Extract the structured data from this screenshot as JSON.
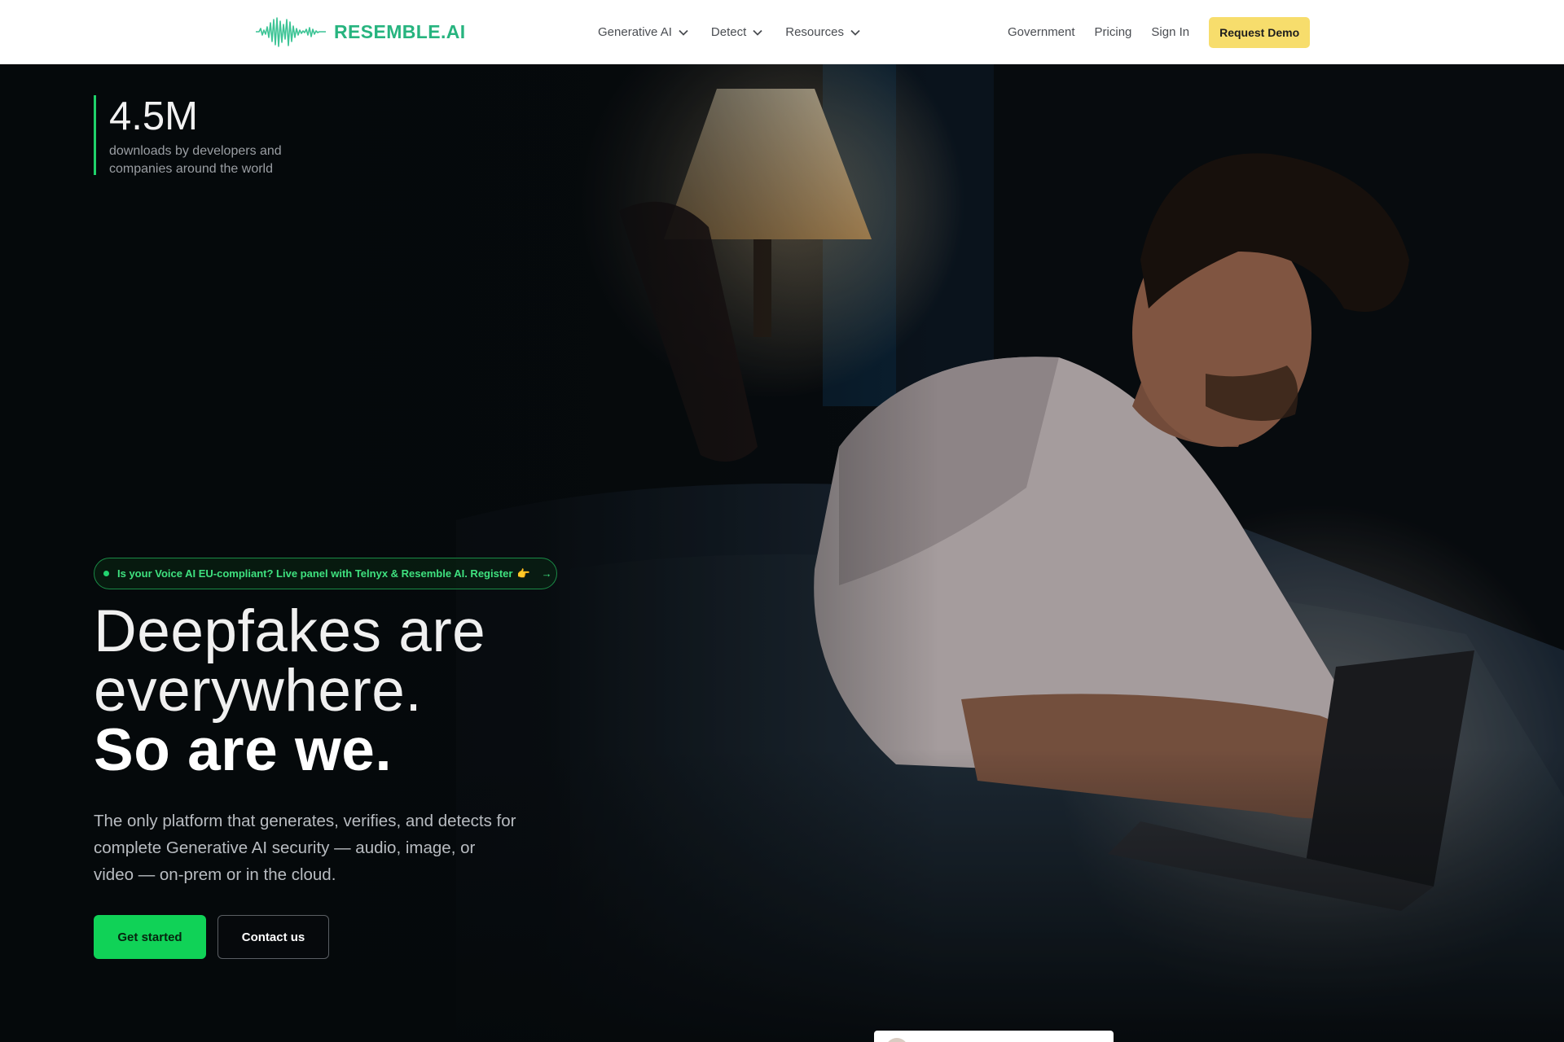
{
  "brand": {
    "name": "RESEMBLE.AI",
    "color": "#27b47f",
    "logo_icon": "waveform-icon"
  },
  "nav": {
    "left_items": [
      {
        "label": "Generative AI",
        "icon": "chevron-down-icon"
      },
      {
        "label": "Detect",
        "icon": "chevron-down-icon"
      },
      {
        "label": "Resources",
        "icon": "chevron-down-icon"
      }
    ],
    "right_items": [
      {
        "label": "Government"
      },
      {
        "label": "Pricing"
      },
      {
        "label": "Sign In"
      }
    ],
    "cta": {
      "label": "Request Demo",
      "color": "#f7dd6c"
    }
  },
  "hero": {
    "stat": {
      "value": "4.5M",
      "description": "downloads by developers and companies around the world"
    },
    "banner": {
      "text": "Is your Voice AI EU-compliant? Live panel with Telnyx & Resemble AI. Register",
      "emoji": "👉",
      "arrow": "→"
    },
    "headline": {
      "line1": "Deepfakes are",
      "line2": "everywhere.",
      "line3": "So are we."
    },
    "subtext": "The only platform that generates, verifies, and detects for complete Generative AI security — audio, image, or video — on-prem or in the cloud.",
    "primary_button": {
      "label": "Get started",
      "color": "#10d257"
    },
    "secondary_button": {
      "label": "Contact us"
    },
    "image_subject": "man-using-laptop-in-bed-photo"
  }
}
